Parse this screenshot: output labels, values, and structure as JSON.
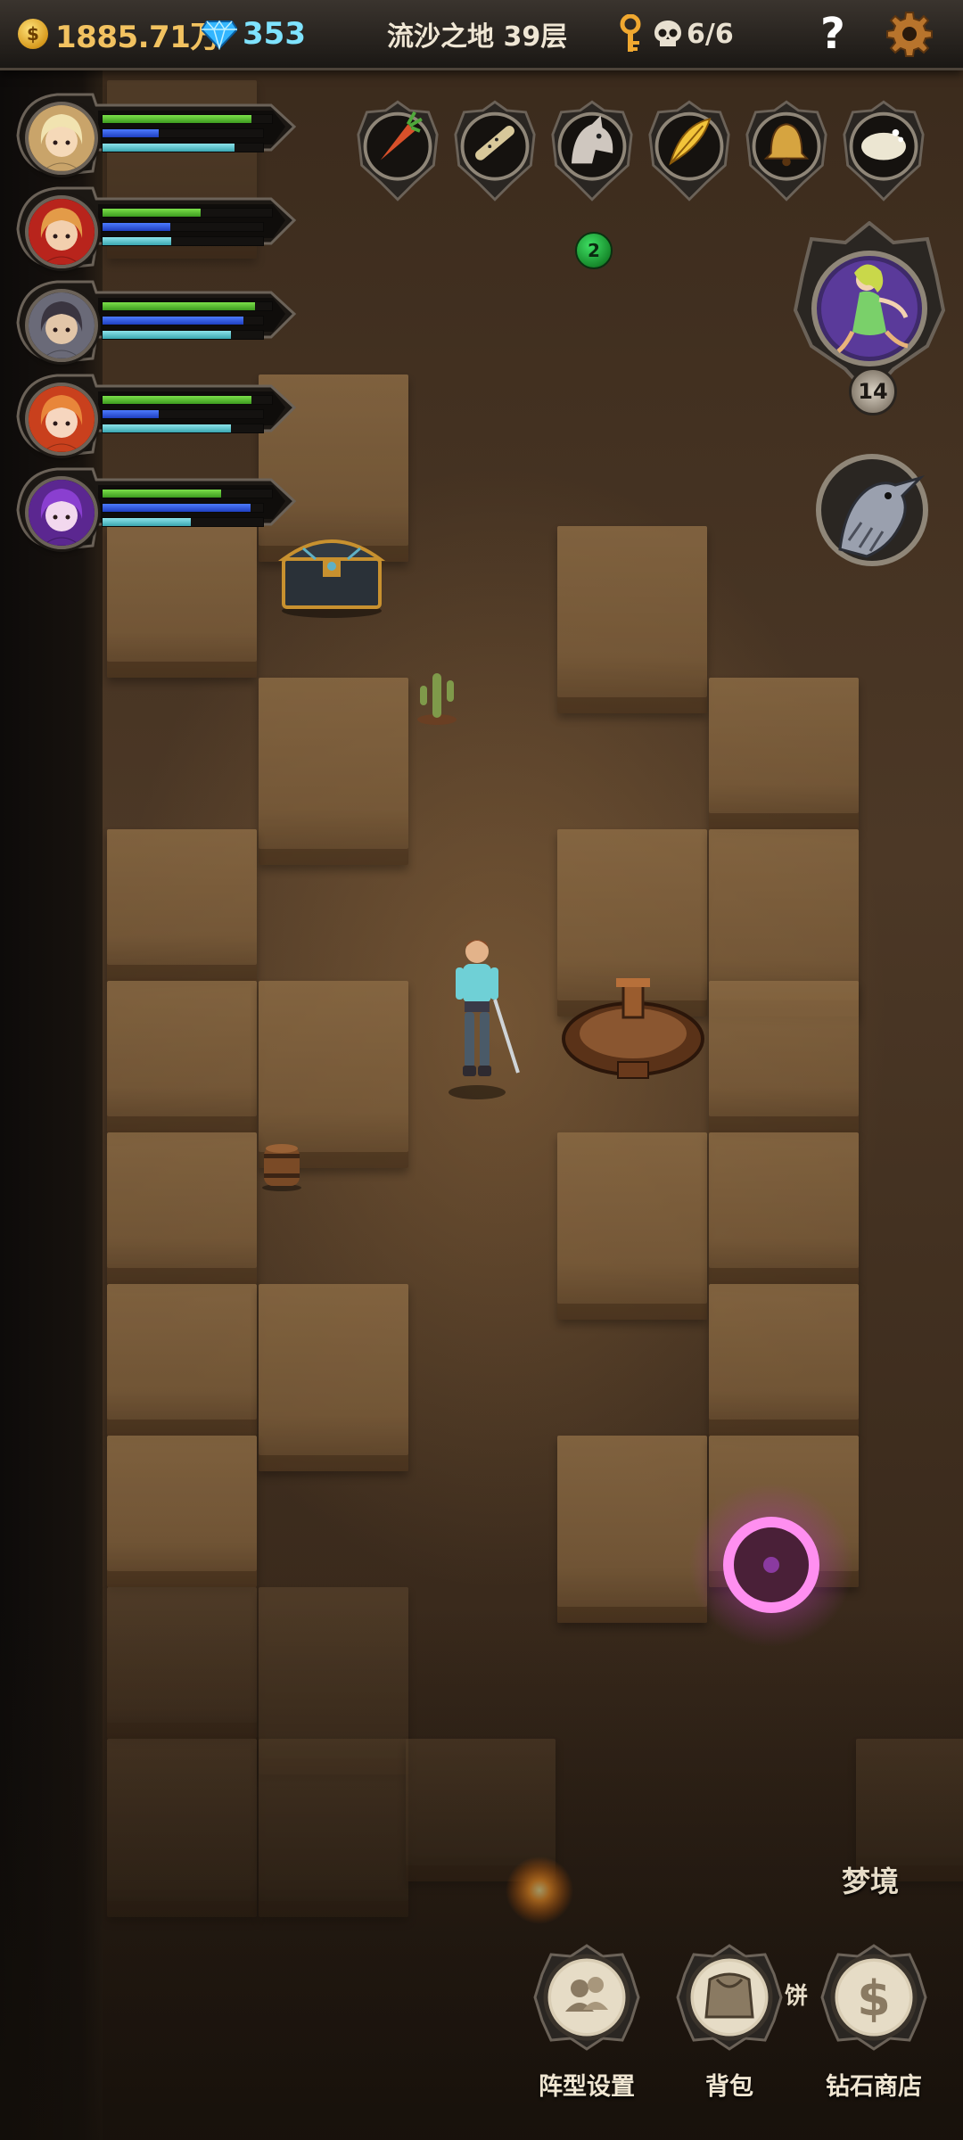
{
  "topbar": {
    "gold": "1885.71万",
    "gems": "353",
    "floor_title": "流沙之地 39层",
    "kills": "6/6",
    "help": "?",
    "coin_symbol": "$"
  },
  "heroes": [
    {
      "name": "hero-blonde-mage",
      "hp": 0.88,
      "mp": 0.35,
      "sp": 0.82,
      "skin": "#f5d9b8",
      "hair": "#f1e3b0",
      "accent": "#c9a46a"
    },
    {
      "name": "hero-red-priest",
      "hp": 0.58,
      "mp": 0.42,
      "sp": 0.43,
      "skin": "#f2cfae",
      "hair": "#e39b48",
      "accent": "#b8241c"
    },
    {
      "name": "hero-dark-knight",
      "hp": 0.9,
      "mp": 0.88,
      "sp": 0.8,
      "skin": "#e2c6a8",
      "hair": "#3a3540",
      "accent": "#6a6a78"
    },
    {
      "name": "hero-orange-witch",
      "hp": 0.88,
      "mp": 0.35,
      "sp": 0.8,
      "skin": "#f6d6bf",
      "hair": "#e8863a",
      "accent": "#c9401d"
    },
    {
      "name": "hero-purple-sorceress",
      "hp": 0.7,
      "mp": 0.92,
      "sp": 0.55,
      "skin": "#f2d8ee",
      "hair": "#8a3fd0",
      "accent": "#5b2790"
    }
  ],
  "relics": [
    {
      "icon": "carrot-icon",
      "color": "#d8502a"
    },
    {
      "icon": "bone-flute-icon",
      "color": "#d8c89a"
    },
    {
      "icon": "wolf-head-icon",
      "color": "#cfc7bf"
    },
    {
      "icon": "golden-feather-icon",
      "color": "#f2c43a"
    },
    {
      "icon": "golden-bell-icon",
      "color": "#d6a440"
    },
    {
      "icon": "soap-icon",
      "color": "#ece6d2"
    }
  ],
  "quest_badge": "2",
  "boss": {
    "level": "14",
    "icon": "dryad-icon"
  },
  "raven": {
    "icon": "raven-icon"
  },
  "dream_label": "梦境",
  "partial_text": "饼",
  "bottom_buttons": [
    {
      "label": "阵型设置",
      "icon": "formation-icon"
    },
    {
      "label": "背包",
      "icon": "backpack-icon"
    },
    {
      "label": "钻石商店",
      "icon": "dollar-icon"
    }
  ],
  "colors": {
    "gold": "#f2c260",
    "gem": "#7fe3ff",
    "portal": "#ff7be6"
  }
}
